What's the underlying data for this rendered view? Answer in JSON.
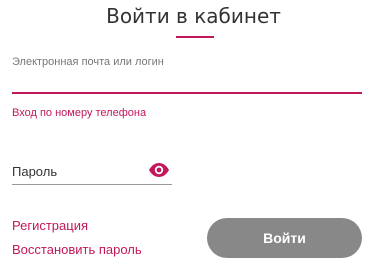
{
  "header": {
    "title": "Войти в кабинет"
  },
  "login": {
    "label": "Электронная почта или логин",
    "value": "",
    "phone_link": "Вход по номеру телефона"
  },
  "password": {
    "placeholder": "Пароль",
    "value": ""
  },
  "links": {
    "register": "Регистрация",
    "restore": "Восстановить пароль"
  },
  "submit": {
    "label": "Войти"
  },
  "colors": {
    "accent": "#c2185b",
    "button": "#888888"
  }
}
